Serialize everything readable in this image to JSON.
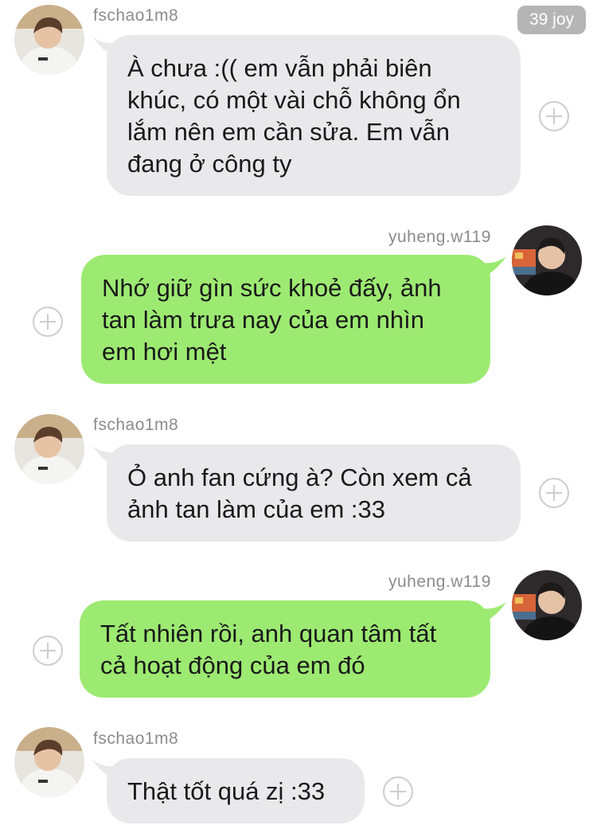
{
  "header": {
    "badge": "39 joy"
  },
  "users": {
    "left": {
      "username": "fschao1m8",
      "avatar_icon": "user-avatar-fschao1m8"
    },
    "right": {
      "username": "yuheng.w119",
      "avatar_icon": "user-avatar-yuheng"
    }
  },
  "messages": [
    {
      "sender": "fschao1m8",
      "side": "left",
      "text": "À chưa :(( em vẫn phải biên khúc, có một vài chỗ không ổn lắm nên em cần sửa. Em vẫn đang ở công ty",
      "lines": [
        "À chưa :(( em vẫn phải biên",
        "khúc, có một vài chỗ không ổn",
        "lắm nên em cần sửa. Em vẫn",
        "đang ở công ty"
      ]
    },
    {
      "sender": "yuheng.w119",
      "side": "right",
      "text": "Nhớ giữ gìn sức khoẻ đấy, ảnh tan làm trưa nay của em nhìn em hơi mệt",
      "lines": [
        "Nhớ giữ gìn sức khoẻ đấy, ảnh",
        "tan làm trưa nay của em nhìn",
        "em hơi mệt"
      ]
    },
    {
      "sender": "fschao1m8",
      "side": "left",
      "text": "Ỏ anh fan cứng à? Còn xem cả ảnh tan làm của em :33",
      "lines": [
        "Ỏ anh fan cứng à? Còn xem cả",
        "ảnh tan làm của em :33"
      ]
    },
    {
      "sender": "yuheng.w119",
      "side": "right",
      "text": "Tất nhiên rồi, anh quan tâm tất cả hoạt động của em đó",
      "lines": [
        "Tất nhiên rồi, anh quan tâm tất",
        "cả hoạt động của em đó"
      ]
    },
    {
      "sender": "fschao1m8",
      "side": "left",
      "text": "Thật tốt quá zị :33",
      "lines": [
        "Thật tốt quá zị :33"
      ]
    }
  ],
  "colors": {
    "incoming_bubble": "#e9e9eb",
    "outgoing_bubble": "#9dea72",
    "username": "#8c8c8c",
    "badge_bg": "#b5b5b5"
  },
  "icons": {
    "react": "add-reaction-icon"
  }
}
